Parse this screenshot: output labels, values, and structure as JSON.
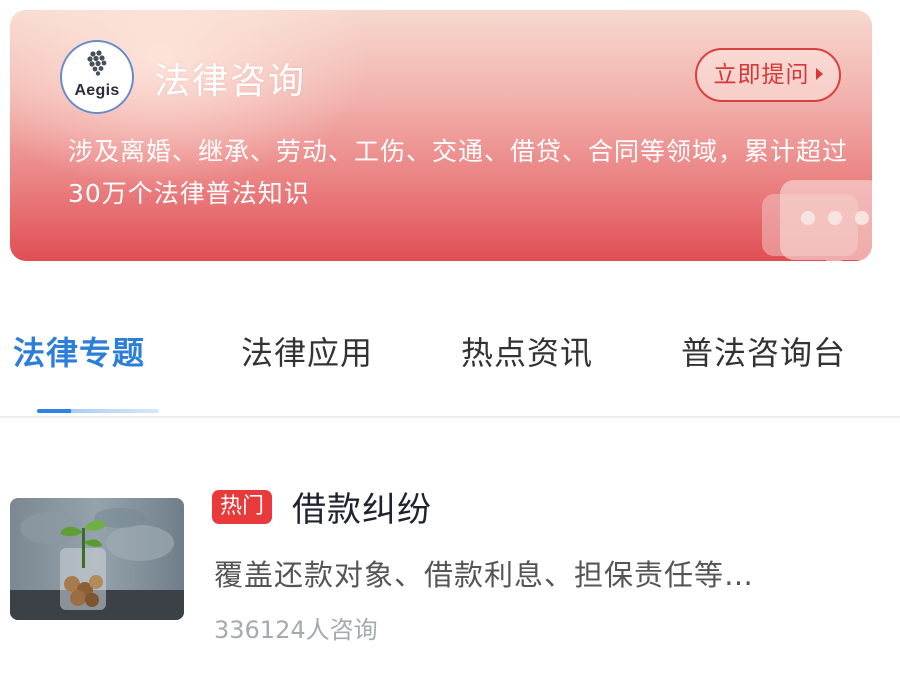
{
  "banner": {
    "logo_text": "Aegis",
    "title": "法律咨询",
    "ask_button": "立即提问",
    "description": "涉及离婚、继承、劳动、工伤、交通、借贷、合同等领域，累计超过30万个法律普法知识"
  },
  "tabs": [
    {
      "label": "法律专题",
      "active": true
    },
    {
      "label": "法律应用",
      "active": false
    },
    {
      "label": "热点资讯",
      "active": false
    },
    {
      "label": "普法咨询台",
      "active": false
    }
  ],
  "article": {
    "badge": "热门",
    "title": "借款纠纷",
    "description": "覆盖还款对象、借款利息、担保责任等…",
    "meta": "336124人咨询"
  },
  "colors": {
    "accent_blue": "#2d7ed8",
    "badge_red": "#e8393b",
    "button_red": "#d63837"
  }
}
